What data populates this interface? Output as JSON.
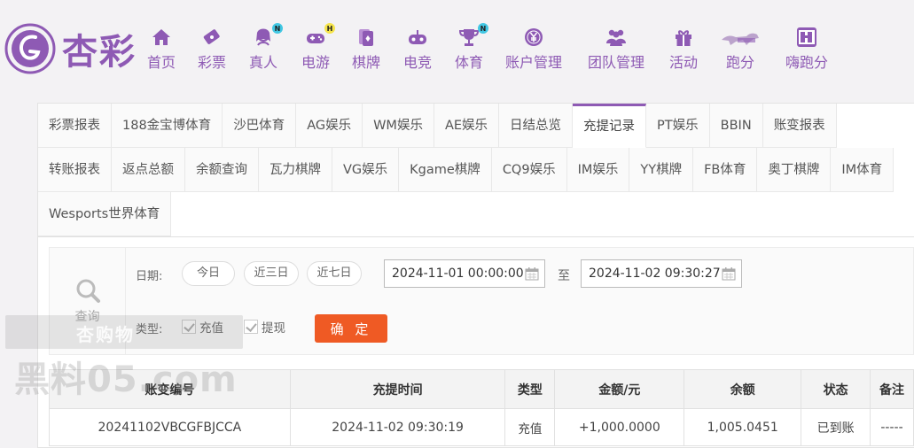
{
  "brand": {
    "name": "杏彩",
    "color": "#8e5ab4"
  },
  "nav": [
    {
      "label": "首页",
      "icon": "home-icon",
      "badge": ""
    },
    {
      "label": "彩票",
      "icon": "lottery-ticket-icon",
      "badge": ""
    },
    {
      "label": "真人",
      "icon": "live-dealer-icon",
      "badge": "N"
    },
    {
      "label": "电游",
      "icon": "gamepad-icon",
      "badge": "H"
    },
    {
      "label": "棋牌",
      "icon": "cards-icon",
      "badge": ""
    },
    {
      "label": "电竞",
      "icon": "esports-controller-icon",
      "badge": ""
    },
    {
      "label": "体育",
      "icon": "trophy-icon",
      "badge": "N"
    },
    {
      "label": "账户管理",
      "icon": "yen-coin-icon",
      "badge": ""
    },
    {
      "label": "团队管理",
      "icon": "team-icon",
      "badge": ""
    },
    {
      "label": "活动",
      "icon": "gift-icon",
      "badge": ""
    },
    {
      "label": "跑分",
      "icon": "running-dog-icon",
      "badge": ""
    },
    {
      "label": "嗨跑分",
      "icon": "hi-badge-icon",
      "badge": "",
      "icon_text": "hi"
    }
  ],
  "tabs_row1": [
    "彩票报表",
    "188金宝博体育",
    "沙巴体育",
    "AG娱乐",
    "WM娱乐",
    "AE娱乐",
    "日结总览",
    "充提记录",
    "PT娱乐",
    "BBIN",
    "账变报表"
  ],
  "tabs_row2": [
    "转账报表",
    "返点总额",
    "余额查询",
    "瓦力棋牌",
    "VG娱乐",
    "Kgame棋牌",
    "CQ9娱乐",
    "IM娱乐",
    "YY棋牌",
    "FB体育",
    "奥丁棋牌",
    "IM体育"
  ],
  "tabs_row3": [
    "Wesports世界体育"
  ],
  "active_tab": "充提记录",
  "search": {
    "side_label": "查询",
    "date_label": "日期:",
    "quick": [
      "今日",
      "近三日",
      "近七日"
    ],
    "start": "2024-11-01 00:00:00",
    "to": "至",
    "end": "2024-11-02 09:30:27",
    "type_label": "类型:",
    "types": [
      "充值",
      "提现"
    ],
    "confirm": "确 定"
  },
  "table": {
    "headers": [
      "账变编号",
      "充提时间",
      "类型",
      "金额/元",
      "余额",
      "状态",
      "备注"
    ],
    "rows": [
      [
        "20241102VBCGFBJCCA",
        "2024-11-02 09:30:19",
        "充值",
        "+1,000.0000",
        "1,005.0451",
        "已到账",
        "-----"
      ]
    ]
  },
  "watermark": {
    "line1": "杏购物",
    "line2": "黑料05.com"
  }
}
